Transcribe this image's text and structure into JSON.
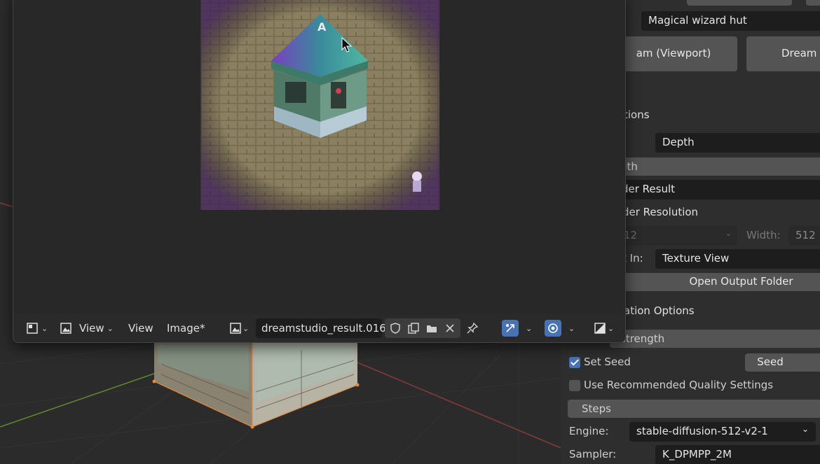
{
  "prompt_field": "Magical wizard hut",
  "buttons": {
    "dream_viewport": "am (Viewport)",
    "dream": "Dream (",
    "seed": "Seed",
    "open_output_folder": "Open Output Folder"
  },
  "sections": {
    "init_options": "tions",
    "generation_options": "ation Options"
  },
  "fields": {
    "init_type": "Depth",
    "strength_slider": "gth",
    "render_result": "der Result",
    "render_resolution_label": "der Resolution",
    "height_value": "12",
    "width_label": "Width:",
    "width_value": "512",
    "open_in_label": "t In:",
    "open_in_value": "Texture View",
    "prompt_strength": "strength",
    "set_seed": "Set Seed",
    "use_recommended": "Use Recommended Quality Settings",
    "steps": "Steps",
    "engine_label": "Engine:",
    "engine_value": "stable-diffusion-512-v2-1",
    "sampler_label": "Sampler:",
    "sampler_value": "K_DPMPP_2M"
  },
  "checkboxes": {
    "set_seed": true,
    "use_recommended": false
  },
  "editor_header": {
    "view_menu_1": "View",
    "view_menu_2": "View",
    "image_menu": "Image*",
    "image_name": "dreamstudio_result.016"
  },
  "icons": {
    "editor_type": "image-editor-icon",
    "mode": "image-view-icon",
    "browse": "image-browse-icon",
    "fake_user": "shield-icon",
    "duplicate": "duplicate-icon",
    "open": "folder-icon",
    "unlink": "close-icon",
    "pin": "pin-icon",
    "gizmo": "gizmo-icon",
    "overlay": "overlay-icon",
    "display_channels": "display-channels-icon"
  },
  "colors": {
    "accent": "#4772b3",
    "panel_bg": "#2e2e2e",
    "field_bg": "#1d1d1d",
    "button_bg": "#545454"
  }
}
